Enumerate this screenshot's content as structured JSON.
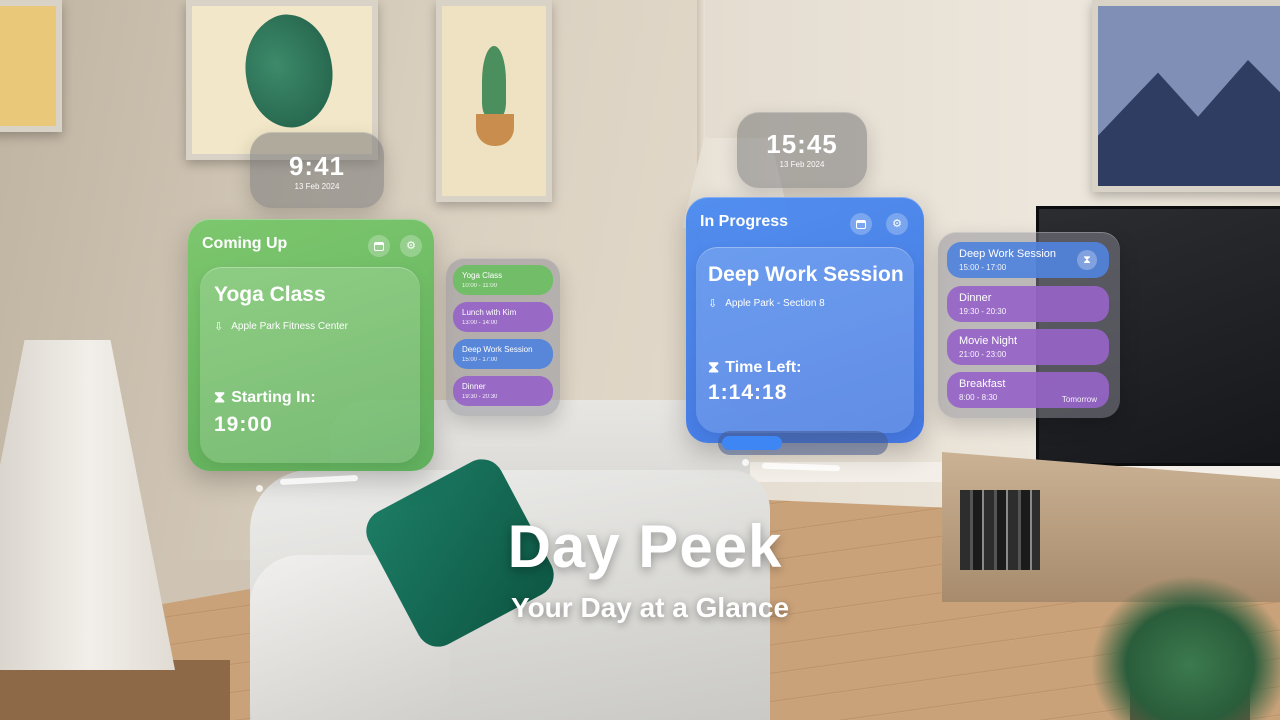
{
  "app": {
    "title": "Day Peek",
    "tagline": "Your Day at a Glance"
  },
  "clock_left": {
    "time": "9:41",
    "date": "13 Feb 2024"
  },
  "clock_right": {
    "time": "15:45",
    "date": "13 Feb 2024"
  },
  "coming_up": {
    "header": "Coming Up",
    "title": "Yoga Class",
    "location": "Apple Park Fitness Center",
    "countdown_label": "Starting In:",
    "countdown_value": "19:00",
    "accent_color": "#6cc25f"
  },
  "in_progress": {
    "header": "In Progress",
    "title": "Deep Work Session",
    "location": "Apple Park - Section 8",
    "countdown_label": "Time Left:",
    "countdown_value": "1:14:18",
    "progress_fraction": 0.35,
    "accent_color": "#4a8af0"
  },
  "schedule_left": [
    {
      "name": "Yoga Class",
      "time": "10:00  -  11:00",
      "color": "green"
    },
    {
      "name": "Lunch with Kim",
      "time": "13:00  -  14:00",
      "color": "purple"
    },
    {
      "name": "Deep Work Session",
      "time": "15:00  -  17:00",
      "color": "blue"
    },
    {
      "name": "Dinner",
      "time": "19:30  -  20:30",
      "color": "purple"
    }
  ],
  "schedule_right": [
    {
      "name": "Deep Work Session",
      "time": "15:00  -  17:00",
      "color": "blue",
      "badge_icon": "hourglass-icon"
    },
    {
      "name": "Dinner",
      "time": "19:30  -  20:30",
      "color": "purple"
    },
    {
      "name": "Movie Night",
      "time": "21:00  -  23:00",
      "color": "purple"
    },
    {
      "name": "Breakfast",
      "time": "8:00  -  8:30",
      "color": "purple",
      "tag": "Tomorrow"
    }
  ],
  "icons": {
    "calendar": "calendar-icon",
    "settings": "gear-icon",
    "location": "location-icon",
    "timer": "hourglass-icon"
  }
}
